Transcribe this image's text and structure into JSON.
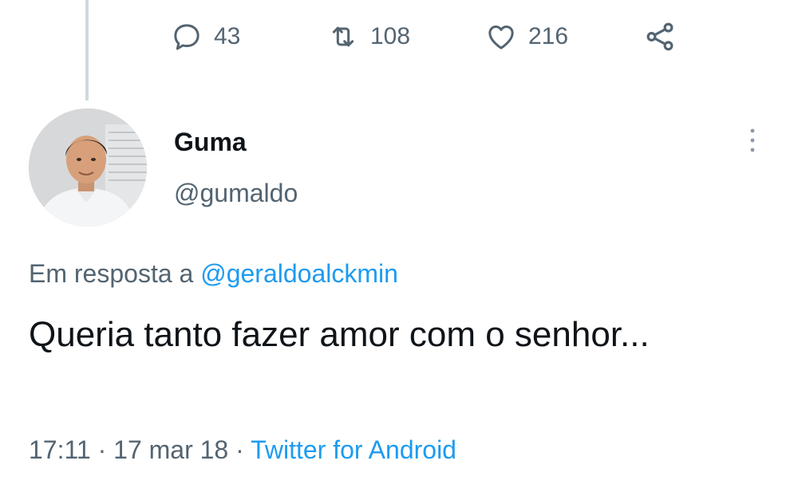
{
  "previous_tweet_actions": {
    "reply_count": "43",
    "retweet_count": "108",
    "like_count": "216"
  },
  "tweet": {
    "author_name": "Guma",
    "author_handle": "@gumaldo",
    "reply_prefix": "Em resposta a ",
    "reply_mention": "@geraldoalckmin",
    "text": "Queria tanto fazer amor com o senhor...",
    "time": "17:11",
    "separator": " · ",
    "date": "17 mar 18",
    "source": "Twitter for Android"
  },
  "icons": {
    "reply": "reply-icon",
    "retweet": "retweet-icon",
    "like": "heart-icon",
    "share": "share-icon",
    "more": "more-vertical-icon"
  },
  "colors": {
    "text": "#0f1419",
    "secondary": "#536471",
    "link": "#1d9bf0",
    "thread_line": "#cfd9de"
  }
}
